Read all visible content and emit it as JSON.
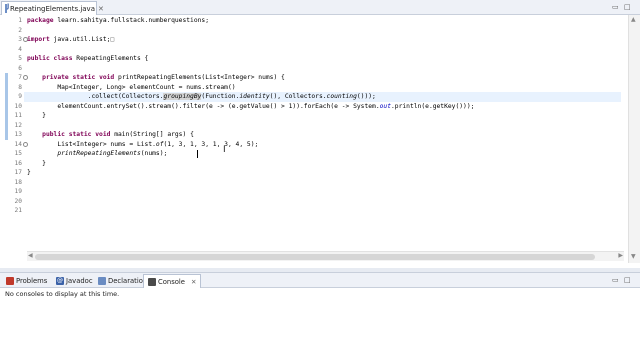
{
  "editor_tab": {
    "label": "RepeatingElements.java",
    "close": "✕"
  },
  "window_controls": {
    "minimize": "▭",
    "maximize": "□"
  },
  "gutter": {
    "line_numbers": [
      "1",
      "2",
      "3",
      "4",
      "5",
      "6",
      "7",
      "8",
      "9",
      "10",
      "11",
      "12",
      "13",
      "14",
      "15",
      "16",
      "17",
      "18",
      "19",
      "20",
      "21"
    ]
  },
  "code": {
    "l1_kw": "package",
    "l1_rest": " learn.sahitya.fullstack.numberquestions;",
    "l3_kw": "import",
    "l3_rest": " java.util.List;",
    "l3_fold": "□",
    "l5_kw1": "public",
    "l5_kw2": "class",
    "l5_rest": " RepeatingElements {",
    "l7_indent": "    ",
    "l7_kw1": "private",
    "l7_kw2": "static",
    "l7_kw3": "void",
    "l7_rest1": " printRepeatingElements(List<Integer> ",
    "l7_param": "nums",
    "l7_rest2": ") {",
    "l8_pre": "        Map<Integer, Long> ",
    "l8_var": "elementCount",
    "l8_mid": " = ",
    "l8_var2": "nums",
    "l8_post": ".stream()",
    "l9_pre": "                .collect(Collectors.",
    "l9_hl": "groupingBy",
    "l9_mid": "(Function.",
    "l9_ital1": "identity",
    "l9_mid2": "(), Collectors.",
    "l9_ital2": "counting",
    "l9_post": "()));",
    "l10_pre": "        ",
    "l10_var": "elementCount",
    "l10_mid1": ".entrySet().stream().filter(",
    "l10_e1": "e",
    "l10_mid2": " -> (",
    "l10_e2": "e",
    "l10_mid3": ".getValue() > 1)).forEach(",
    "l10_e3": "e",
    "l10_mid4": " -> System.",
    "l10_out": "out",
    "l10_mid5": ".println(",
    "l10_e4": "e",
    "l10_post": ".getKey()));",
    "l11": "    }",
    "l13_indent": "    ",
    "l13_kw1": "public",
    "l13_kw2": "static",
    "l13_kw3": "void",
    "l13_rest1": " main(String[] ",
    "l13_param": "args",
    "l13_rest2": ") {",
    "l14_pre": "        List<Integer> ",
    "l14_var": "nums",
    "l14_mid": " = List.",
    "l14_ital": "of",
    "l14_post": "(1, 3, 1, 3, 1, 3, 4, 5);",
    "l15_pre": "        ",
    "l15_ital": "printRepeatingElements",
    "l15_mid": "(",
    "l15_var": "nums",
    "l15_post": ");",
    "l16": "    }",
    "l17": "}"
  },
  "bottom_panel": {
    "tabs": [
      {
        "label": "Problems",
        "icon": "problems-icon",
        "color": "#c0392b"
      },
      {
        "label": "Javadoc",
        "icon": "javadoc-icon",
        "color": "#3b62a8"
      },
      {
        "label": "Declaration",
        "icon": "declaration-icon",
        "color": "#6a8cc2"
      },
      {
        "label": "Console",
        "icon": "console-icon",
        "color": "#4a4a4a"
      }
    ],
    "console_close": "✕",
    "message": "No consoles to display at this time.",
    "controls": {
      "minimize": "▭",
      "maximize": "□"
    }
  },
  "scrollbars": {
    "up": "▲",
    "down": "▼",
    "left": "◀",
    "right": "▶"
  }
}
